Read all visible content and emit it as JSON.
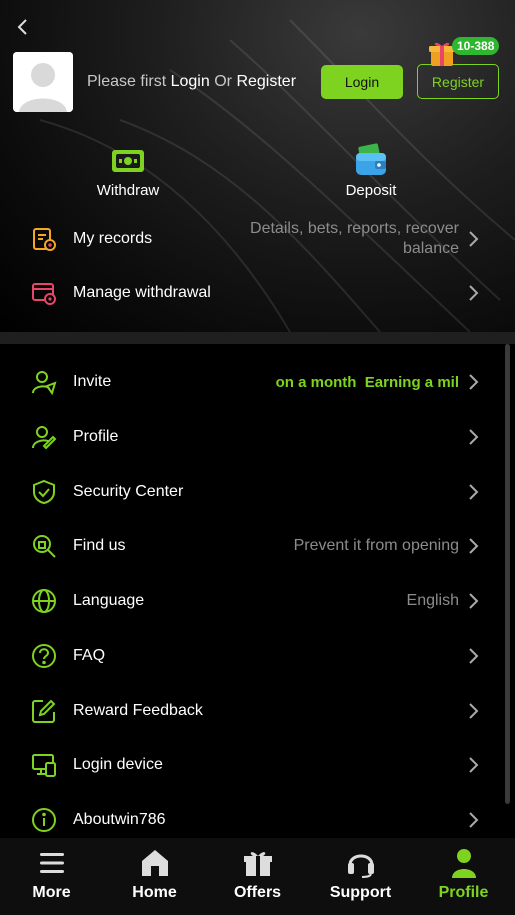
{
  "header": {
    "login_prompt_prefix": "Please first",
    "login_link": "Login",
    "or_text": "Or",
    "register_link": "Register",
    "login_button": "Login",
    "register_button": "Register",
    "gift_badge": "10-388"
  },
  "wallet": {
    "withdraw": "Withdraw",
    "deposit": "Deposit"
  },
  "records": {
    "my_records": {
      "label": "My records",
      "value_line1": "Details, bets, reports, recover",
      "value_line2": "balance"
    },
    "manage_withdrawal": {
      "label": "Manage withdrawal"
    }
  },
  "menu": {
    "invite": {
      "label": "Invite",
      "value_a": "on a month",
      "value_b": "Earning a mil"
    },
    "profile": {
      "label": "Profile"
    },
    "security": {
      "label": "Security Center"
    },
    "findus": {
      "label": "Find us",
      "value": "Prevent it from opening"
    },
    "language": {
      "label": "Language",
      "value": "English"
    },
    "faq": {
      "label": "FAQ"
    },
    "reward": {
      "label": "Reward Feedback"
    },
    "device": {
      "label": "Login device"
    },
    "about": {
      "label": "Aboutwin786"
    }
  },
  "tabs": {
    "more": "More",
    "home": "Home",
    "offers": "Offers",
    "support": "Support",
    "profile": "Profile"
  },
  "colors": {
    "accent": "#7ed321",
    "badge": "#2fb52f",
    "records_icon": "#f5a623",
    "withdrawal_icon": "#e8456b"
  }
}
